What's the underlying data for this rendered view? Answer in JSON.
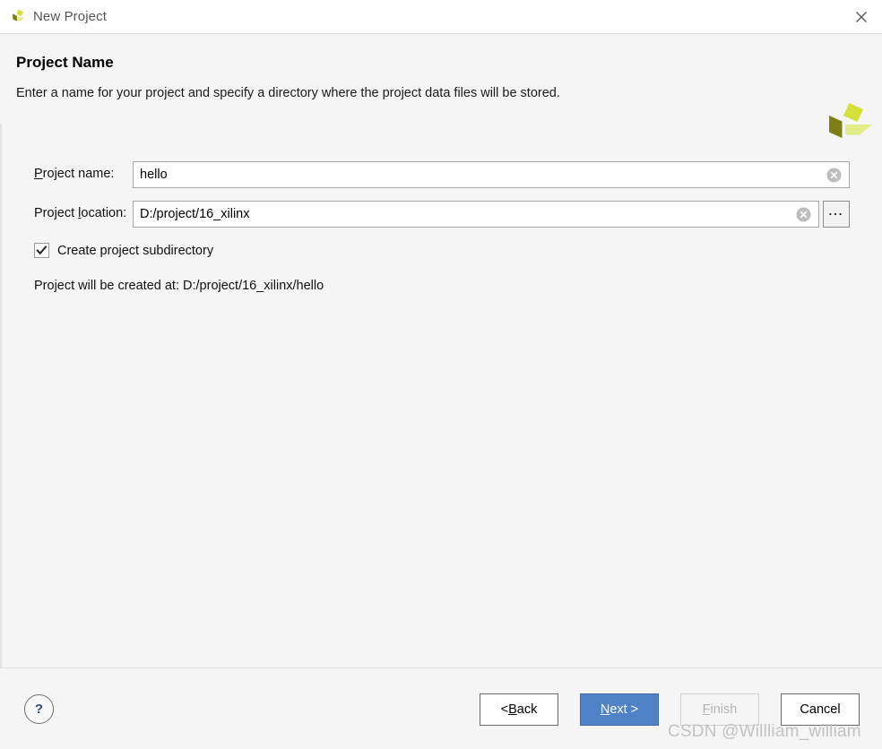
{
  "window": {
    "title": "New Project",
    "icon": "vivado-logo-icon",
    "close_icon": "close-icon"
  },
  "header": {
    "title": "Project Name",
    "subtitle": "Enter a name for your project and specify a directory where the project data files will be stored.",
    "brand_icon": "vivado-pinwheel-logo"
  },
  "form": {
    "project_name": {
      "label_pre": "",
      "label_mnemonic": "P",
      "label_post": "roject name:",
      "value": "hello",
      "placeholder": "",
      "clear_icon": "clear-circle-icon"
    },
    "project_location": {
      "label_pre": "Project ",
      "label_mnemonic": "l",
      "label_post": "ocation:",
      "value": "D:/project/16_xilinx",
      "placeholder": "",
      "clear_icon": "clear-circle-icon",
      "browse_label": "...",
      "browse_icon": "ellipsis-icon"
    },
    "create_subdirectory": {
      "label": "Create project subdirectory",
      "checked": true
    },
    "created_at": "Project will be created at: D:/project/16_xilinx/hello"
  },
  "footer": {
    "help_label": "?",
    "buttons": {
      "back": {
        "pre": "< ",
        "mnemonic": "B",
        "post": "ack",
        "enabled": true
      },
      "next": {
        "pre": "",
        "mnemonic": "N",
        "post": "ext >",
        "enabled": true,
        "primary": true
      },
      "finish": {
        "pre": "",
        "mnemonic": "F",
        "post": "inish",
        "enabled": false
      },
      "cancel": {
        "pre": "Cancel",
        "mnemonic": "",
        "post": "",
        "enabled": true
      }
    }
  },
  "watermark": "CSDN @Willliam_william",
  "colors": {
    "primary_button": "#4f81c7",
    "dialog_background": "#f5f5f5",
    "titlebar_background": "#ffffff",
    "brand_yellow_green": "#d6e03a",
    "brand_olive": "#7b7f14",
    "brand_pale": "#e4ec87",
    "help_blue": "#2e4a7d",
    "disabled_text": "#b4b4b4"
  }
}
